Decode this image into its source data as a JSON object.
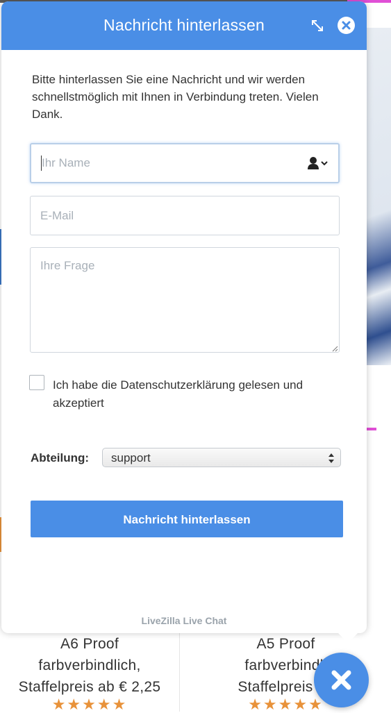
{
  "chat": {
    "title": "Nachricht hinterlassen",
    "intro": "Bitte hinterlassen Sie eine Nachricht und wir werden schnellstmöglich mit Ihnen in Verbindung treten. Vielen Dank.",
    "name_placeholder": "Ihr Name",
    "email_placeholder": "E-Mail",
    "question_placeholder": "Ihre Frage",
    "consent_label": "Ich habe die Datenschutzerklärung gelesen und akzeptiert",
    "department_label": "Abteilung:",
    "department_value": "support",
    "submit_label": "Nachricht hinterlassen",
    "footer": "LiveZilla Live Chat",
    "icons": {
      "expand": "expand-icon",
      "close": "close-icon",
      "user": "user-dropdown-icon",
      "fab": "close-icon"
    },
    "colors": {
      "accent": "#4a8ee6",
      "stars": "#e8923a"
    }
  },
  "products": [
    {
      "title": "A6 Proof",
      "line2": "farbverbindlich,",
      "line3": "Staffelpreis ab € 2,25",
      "stars": "★★★★★"
    },
    {
      "title": "A5 Proof",
      "line2": "farbverbindli",
      "line3": "Staffelpreis ab",
      "stars": "★★★★★"
    }
  ]
}
